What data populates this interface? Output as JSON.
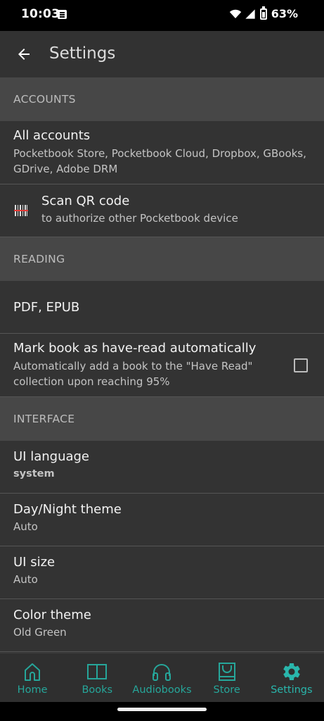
{
  "status_bar": {
    "time": "10:03",
    "battery": "63%",
    "icons": [
      "notification-icon",
      "wifi-icon",
      "signal-icon",
      "battery-icon"
    ]
  },
  "appbar": {
    "title": "Settings",
    "back_icon": "arrow-back-icon"
  },
  "sections": {
    "accounts": "ACCOUNTS",
    "reading": "READING",
    "interface": "INTERFACE"
  },
  "items": {
    "all_accounts": {
      "title": "All accounts",
      "subtitle": "Pocketbook Store, Pocketbook Cloud, Dropbox, GBooks, GDrive, Adobe DRM"
    },
    "scan_qr": {
      "title": "Scan QR code",
      "subtitle": "to authorize other Pocketbook device",
      "icon": "barcode-scan-icon"
    },
    "pdf_epub": {
      "title": "PDF, EPUB"
    },
    "mark_read": {
      "title": "Mark book as have-read automatically",
      "subtitle": "Automatically add a book to the \"Have Read\" collection upon reaching 95%",
      "checked": false
    },
    "ui_language": {
      "title": "UI language",
      "value": "system"
    },
    "day_night": {
      "title": "Day/Night theme",
      "value": "Auto"
    },
    "ui_size": {
      "title": "UI size",
      "value": "Auto"
    },
    "color_theme": {
      "title": "Color theme",
      "value": "Old Green"
    }
  },
  "bottom_nav": [
    {
      "label": "Home",
      "icon": "home-icon"
    },
    {
      "label": "Books",
      "icon": "book-icon"
    },
    {
      "label": "Audiobooks",
      "icon": "headphones-icon"
    },
    {
      "label": "Store",
      "icon": "store-bag-icon"
    },
    {
      "label": "Settings",
      "icon": "gear-icon",
      "active": true
    }
  ],
  "colors": {
    "accent": "#26a69a",
    "background": "#333333",
    "section_header": "#474747",
    "appbar": "#323232"
  }
}
